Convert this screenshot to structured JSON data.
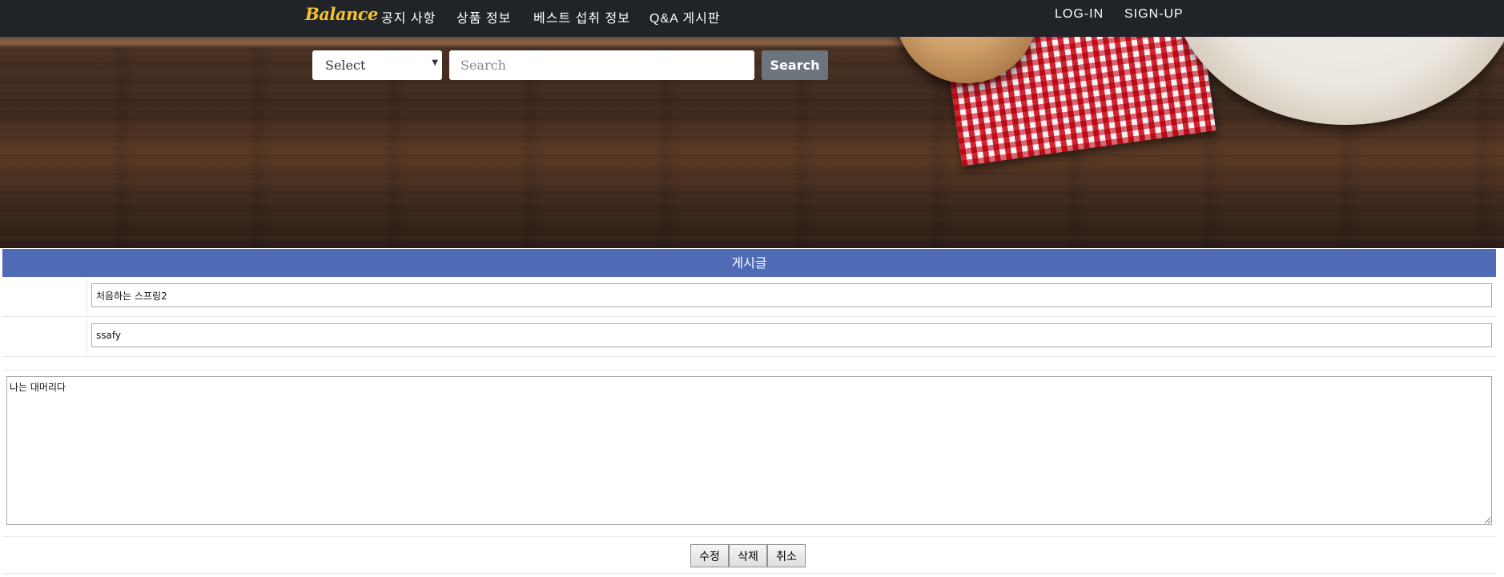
{
  "navbar": {
    "brand": "Balance",
    "links": [
      "공지 사항",
      "상품 정보",
      "베스트 섭취 정보",
      "Q&A 게시판"
    ],
    "auth": [
      "LOG-IN",
      "SIGN-UP"
    ]
  },
  "search": {
    "select_value": "Select",
    "placeholder": "Search",
    "button_label": "Search"
  },
  "board": {
    "header": "게시글",
    "title_value": "처음하는 스프링2",
    "writer_value": "ssafy",
    "content_value": "나는 대머리다",
    "buttons": [
      "수정",
      "삭제",
      "취소"
    ]
  },
  "colors": {
    "navbar_bg": "#202327",
    "brand": "#f2c230",
    "board_header": "#4f6bb5",
    "search_button": "#6c757d"
  },
  "icons": {
    "select_caret": "caret-down-icon"
  }
}
